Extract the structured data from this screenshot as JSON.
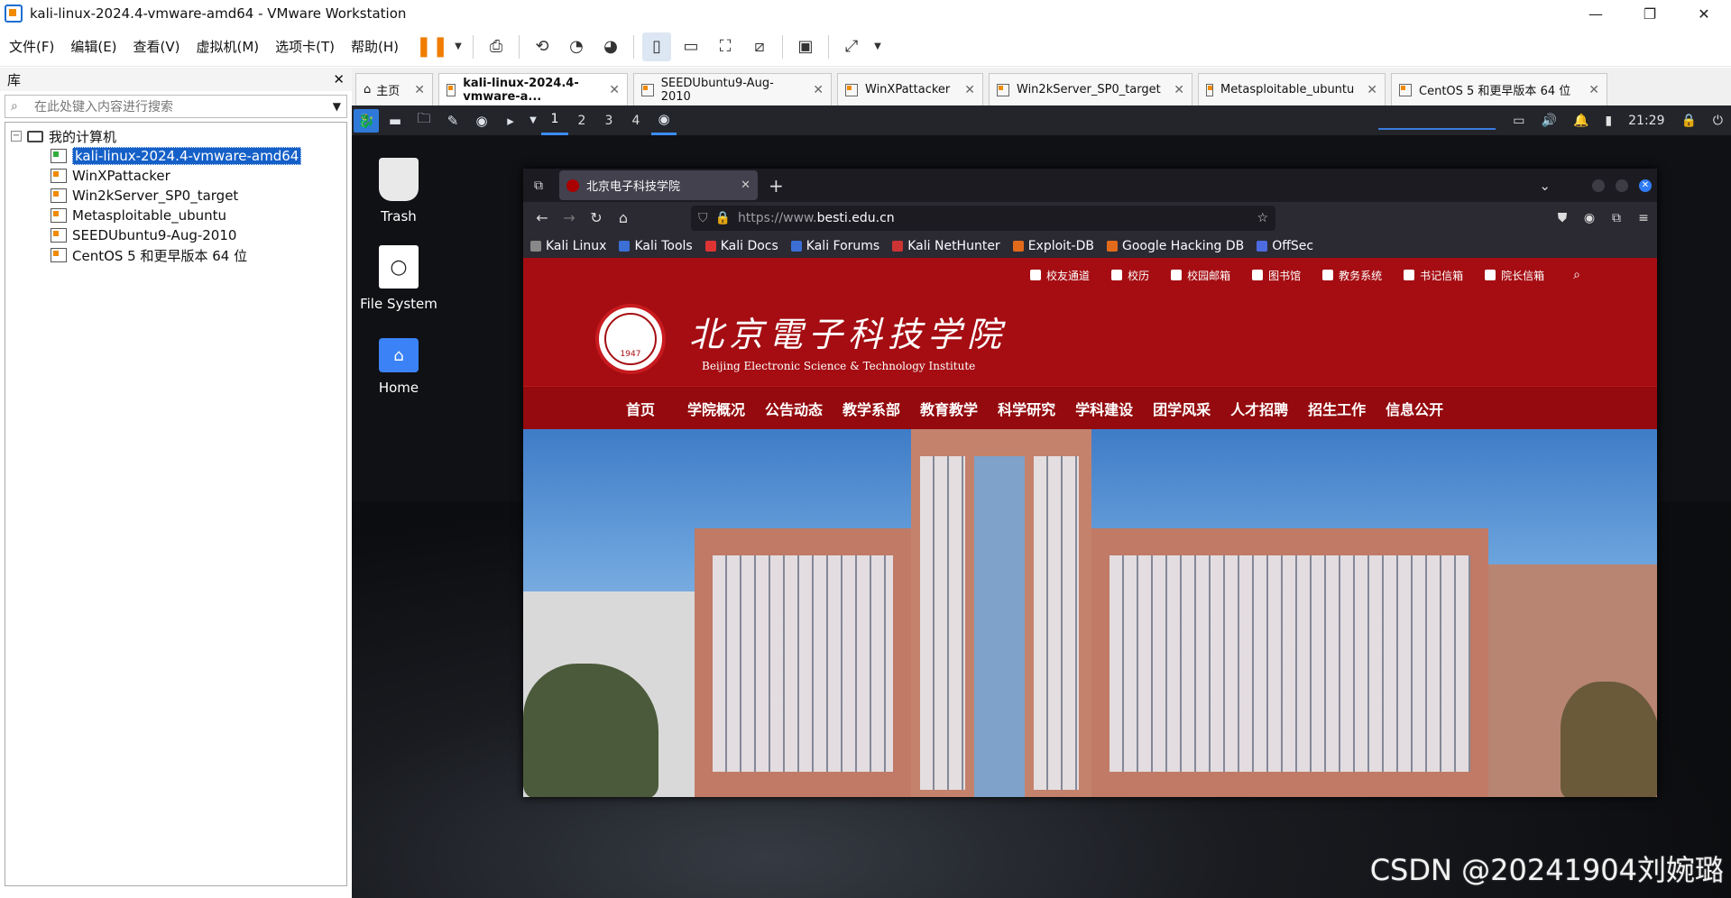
{
  "window": {
    "title": "kali-linux-2024.4-vmware-amd64 - VMware Workstation"
  },
  "menubar": {
    "items": [
      "文件(F)",
      "编辑(E)",
      "查看(V)",
      "虚拟机(M)",
      "选项卡(T)",
      "帮助(H)"
    ]
  },
  "library": {
    "title": "库",
    "search_placeholder": "在此处键入内容进行搜索",
    "root": "我的计算机",
    "items": [
      {
        "label": "kali-linux-2024.4-vmware-amd64",
        "selected": true
      },
      {
        "label": "WinXPattacker"
      },
      {
        "label": "Win2kServer_SP0_target"
      },
      {
        "label": "Metasploitable_ubuntu"
      },
      {
        "label": "SEEDUbuntu9-Aug-2010"
      },
      {
        "label": "CentOS 5 和更早版本 64 位"
      }
    ]
  },
  "vmtabs": [
    {
      "label": "主页"
    },
    {
      "label": "kali-linux-2024.4-vmware-a...",
      "active": true
    },
    {
      "label": "SEEDUbuntu9-Aug-2010"
    },
    {
      "label": "WinXPattacker"
    },
    {
      "label": "Win2kServer_SP0_target"
    },
    {
      "label": "Metasploitable_ubuntu"
    },
    {
      "label": "CentOS 5 和更早版本 64 位"
    }
  ],
  "kali": {
    "workspaces": [
      "1",
      "2",
      "3",
      "4"
    ],
    "clock": "21:29",
    "desktop_icons": [
      {
        "label": "Trash",
        "icon": "trash-icon"
      },
      {
        "label": "File System",
        "icon": "drive-icon"
      },
      {
        "label": "Home",
        "icon": "home-folder-icon"
      }
    ]
  },
  "firefox": {
    "tab_title": "北京电子科技学院",
    "url_scheme": "https://www.",
    "url_host": "besti.edu.cn",
    "bookmarks": [
      "Kali Linux",
      "Kali Tools",
      "Kali Docs",
      "Kali Forums",
      "Kali NetHunter",
      "Exploit-DB",
      "Google Hacking DB",
      "OffSec"
    ]
  },
  "site": {
    "top_links": [
      "校友通道",
      "校历",
      "校园邮箱",
      "图书馆",
      "教务系统",
      "书记信箱",
      "院长信箱"
    ],
    "name_cn": "北京電子科技学院",
    "name_en": "Beijing Electronic Science & Technology Institute",
    "seal_year": "1947",
    "nav": [
      "首页",
      "学院概况",
      "公告动态",
      "教学系部",
      "教育教学",
      "科学研究",
      "学科建设",
      "团学风采",
      "人才招聘",
      "招生工作",
      "信息公开"
    ]
  },
  "watermark": "CSDN @20241904刘婉璐",
  "colors": {
    "site_red": "#a50d12",
    "accent_blue": "#1560c8",
    "pause_orange": "#f07c00"
  }
}
